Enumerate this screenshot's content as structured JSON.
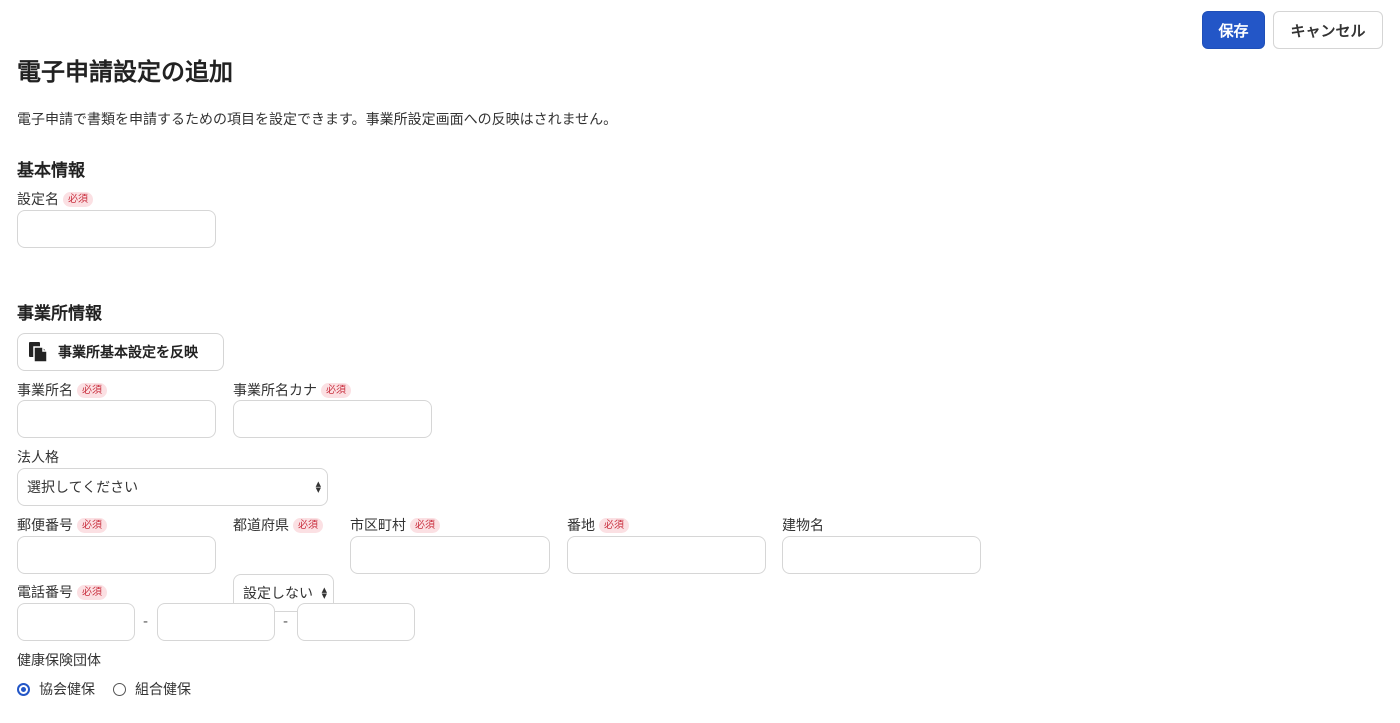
{
  "header": {
    "save_label": "保存",
    "cancel_label": "キャンセル"
  },
  "page": {
    "title": "電子申請設定の追加",
    "description": "電子申請で書類を申請するための項目を設定できます。事業所設定画面への反映はされません。"
  },
  "required_badge": "必須",
  "basic_info": {
    "title": "基本情報",
    "setting_name_label": "設定名",
    "setting_name_value": ""
  },
  "office_info": {
    "title": "事業所情報",
    "apply_button_label": "事業所基本設定を反映",
    "office_name_label": "事業所名",
    "office_name_kana_label": "事業所名カナ",
    "corporate_type_label": "法人格",
    "corporate_type_value": "選択してください",
    "postal_code_label": "郵便番号",
    "prefecture_label": "都道府県",
    "prefecture_value": "設定しない",
    "city_label": "市区町村",
    "street_label": "番地",
    "building_label": "建物名",
    "phone_label": "電話番号",
    "phone_separator": "-",
    "insurance_label": "健康保険団体",
    "insurance_options": [
      {
        "label": "協会健保",
        "checked": true
      },
      {
        "label": "組合健保",
        "checked": false
      }
    ]
  },
  "colors": {
    "primary": "#2356c7",
    "badge_bg": "#fbe0e3",
    "badge_text": "#c9303f"
  }
}
